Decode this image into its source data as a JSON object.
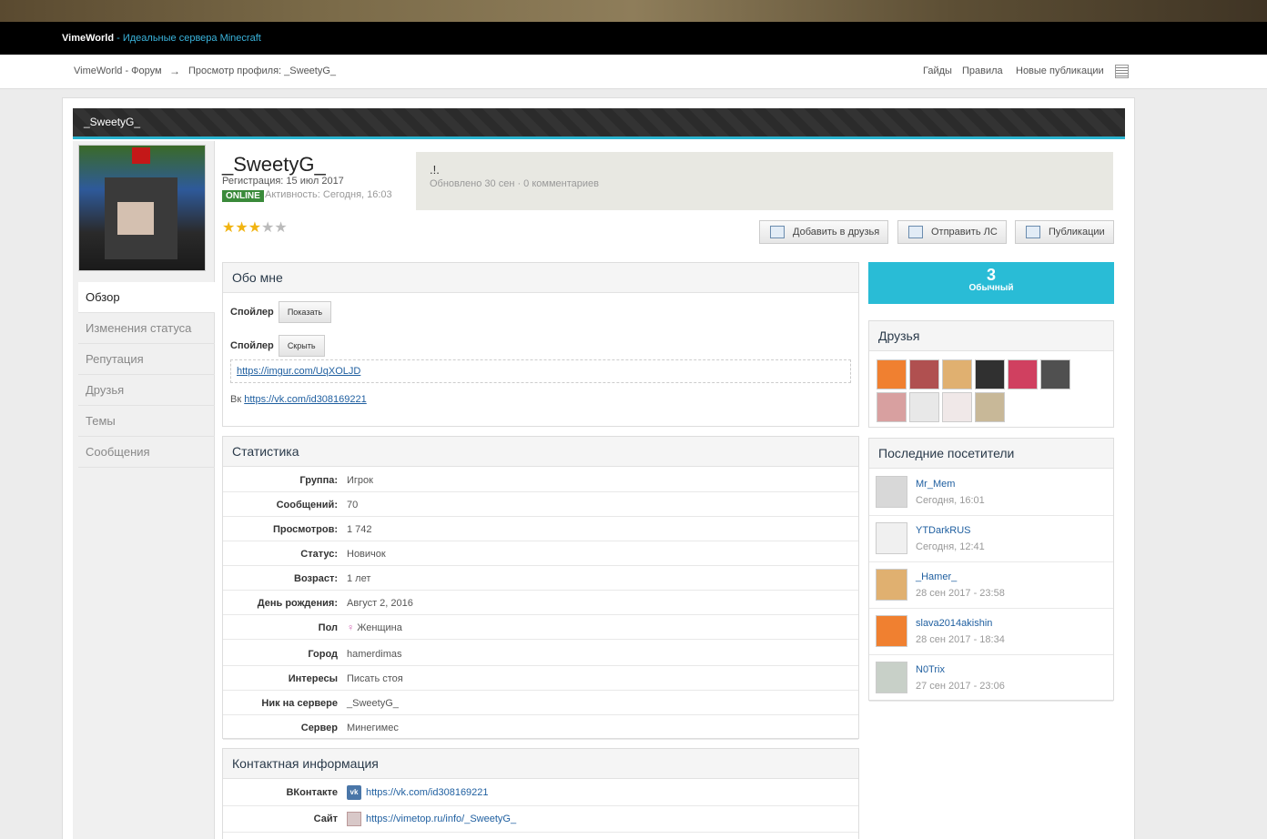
{
  "header": {
    "brand": "VimeWorld",
    "separator": " - ",
    "tagline": "Идеальные сервера Minecraft"
  },
  "breadcrumb": {
    "forum": "VimeWorld - Форум",
    "arrow": "→",
    "current": "Просмотр профиля: _SweetyG_"
  },
  "toplinks": [
    "Гайды",
    "Правила",
    "Новые публикации"
  ],
  "page_title": "_SweetyG_",
  "profile": {
    "username": "_SweetyG_",
    "registration": "Регистрация: 15 июл 2017",
    "online_badge": "ONLINE",
    "activity": "Активность: Сегодня, 16:03",
    "rating": 3,
    "rating_max": 5,
    "status_text": ".!.",
    "status_meta": "Обновлено 30 сен · 0 комментариев"
  },
  "buttons": {
    "add_friend": "Добавить в друзья",
    "send_pm": "Отправить ЛС",
    "publications": "Публикации"
  },
  "sidebar": {
    "items": [
      "Обзор",
      "Изменения статуса",
      "Репутация",
      "Друзья",
      "Темы",
      "Сообщения"
    ]
  },
  "about": {
    "title": "Обо мне",
    "spoiler_label": "Спойлер",
    "show_label": "Показать",
    "hide_label": "Скрыть",
    "imgur_link": "https://imgur.com/UqXOLJD",
    "vk_prefix": "Вк",
    "vk_link": "https://vk.com/id308169221"
  },
  "stats": {
    "title": "Статистика",
    "rows": [
      {
        "k": "Группа:",
        "v": "Игрок"
      },
      {
        "k": "Сообщений:",
        "v": "70"
      },
      {
        "k": "Просмотров:",
        "v": "1 742"
      },
      {
        "k": "Статус:",
        "v": "Новичок"
      },
      {
        "k": "Возраст:",
        "v": "1 лет"
      },
      {
        "k": "День рождения:",
        "v": "Август 2, 2016"
      },
      {
        "k": "Пол",
        "v": "Женщина"
      },
      {
        "k": "Город",
        "v": "hamerdimas"
      },
      {
        "k": "Интересы",
        "v": "Писать стоя"
      },
      {
        "k": "Ник на сервере",
        "v": "_SweetyG_"
      },
      {
        "k": "Сервер",
        "v": "Минегимес"
      }
    ]
  },
  "contacts": {
    "title": "Контактная информация",
    "rows": [
      {
        "k": "ВКонтакте",
        "v": "https://vk.com/id308169221",
        "icon": "vk-icon"
      },
      {
        "k": "Сайт",
        "v": "https://vimetop.ru/info/_SweetyG_",
        "icon": "site-icon"
      }
    ]
  },
  "reputation": {
    "value": "3",
    "label": "Обычный",
    "color": "#29bcd6"
  },
  "friends": {
    "title": "Друзья",
    "colors": [
      "#f08030",
      "#b05050",
      "#e0b070",
      "#303030",
      "#d04060",
      "#505050",
      "#d8a0a0",
      "#e8e8e8",
      "#f0e8e8",
      "#c8b898"
    ]
  },
  "visitors": {
    "title": "Последние посетители",
    "items": [
      {
        "name": "Mr_Mem",
        "time": "Сегодня, 16:01",
        "color": "#d8d8d8"
      },
      {
        "name": "YTDarkRUS",
        "time": "Сегодня, 12:41",
        "color": "#f0f0f0"
      },
      {
        "name": "_Hamer_",
        "time": "28 сен 2017 - 23:58",
        "color": "#e0b070"
      },
      {
        "name": "slava2014akishin",
        "time": "28 сен 2017 - 18:34",
        "color": "#f08030"
      },
      {
        "name": "N0Trix",
        "time": "27 сен 2017 - 23:06",
        "color": "#c8d0c8"
      }
    ]
  }
}
